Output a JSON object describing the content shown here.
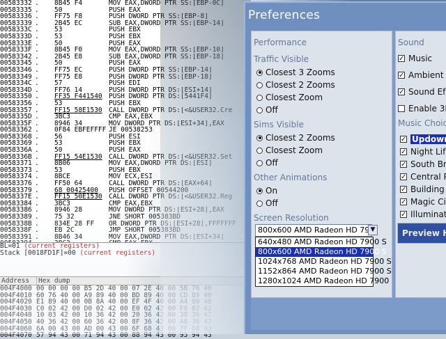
{
  "debugger": {
    "disasm": [
      {
        "addr": "00583332",
        "hex": "8B45 F4",
        "ins": "MOV EAX,DWORD PTR SS:[EBP-0C]"
      },
      {
        "addr": "00583335",
        "hex": "50",
        "ins": "PUSH EAX"
      },
      {
        "addr": "00583336",
        "hex": "FF75 F8",
        "ins": "PUSH DWORD PTR SS:[EBP-8]"
      },
      {
        "addr": "00583339",
        "hex": "2B45 EC",
        "ins": "SUB EAX,DWORD PTR SS:[EBP-14]"
      },
      {
        "addr": "0058333C",
        "hex": "53",
        "ins": "PUSH EBX"
      },
      {
        "addr": "0058333D",
        "hex": "53",
        "ins": "PUSH EBX"
      },
      {
        "addr": "0058333E",
        "hex": "50",
        "ins": "PUSH EAX"
      },
      {
        "addr": "0058333F",
        "hex": "8B45 F0",
        "ins": "MOV EAX,DWORD PTR SS:[EBP-10]"
      },
      {
        "addr": "00583342",
        "hex": "2B45 E8",
        "ins": "SUB EAX,DWORD PTR SS:[EBP-18]"
      },
      {
        "addr": "00583345",
        "hex": "50",
        "ins": "PUSH EAX"
      },
      {
        "addr": "00583346",
        "hex": "FF75 EC",
        "ins": "PUSH DWORD PTR SS:[EBP-14]"
      },
      {
        "addr": "00583349",
        "hex": "FF75 E8",
        "ins": "PUSH DWORD PTR SS:[EBP-18]"
      },
      {
        "addr": "0058334C",
        "hex": "57",
        "ins": "PUSH EDI"
      },
      {
        "addr": "0058334D",
        "hex": "FF76 14",
        "ins": "PUSH DWORD PTR DS:[ESI+14]"
      },
      {
        "addr": "00583350",
        "hex": "FF35 F441540",
        "ins": "PUSH DWORD PTR DS:[5441F4]",
        "u": true
      },
      {
        "addr": "00583356",
        "hex": "53",
        "ins": "PUSH EBX"
      },
      {
        "addr": "00583357",
        "hex": "FF15 58E1530",
        "ins": "CALL DWORD PTR DS:[<&USER32.Cre",
        "u": true
      },
      {
        "addr": "0058335D",
        "hex": "3BC3",
        "ins": "CMP EAX,EBX"
      },
      {
        "addr": "0058335F",
        "hex": "8946 34",
        "ins": "MOV DWORD PTR DS:[ESI+34],EAX"
      },
      {
        "addr": "00583362",
        "hex": "0F84 EBFEFFFF",
        "ins": "JE 00538253"
      },
      {
        "addr": "00583368",
        "hex": "56",
        "ins": "PUSH ESI"
      },
      {
        "addr": "00583369",
        "hex": "53",
        "ins": "PUSH EBX"
      },
      {
        "addr": "0058336A",
        "hex": "50",
        "ins": "PUSH EAX"
      },
      {
        "addr": "0058336B",
        "hex": "FF15 54E1530",
        "ins": "CALL DWORD PTR DS:[<&USER32.Set",
        "u": true
      },
      {
        "addr": "00583371",
        "hex": "8B06",
        "ins": "MOV EAX,DWORD PTR DS:[ESI]"
      },
      {
        "addr": "00583373",
        "hex": "53",
        "ins": "PUSH EBX"
      },
      {
        "addr": "00583374",
        "hex": "8BCE",
        "ins": "MOV ECX,ESI"
      },
      {
        "addr": "00583376",
        "hex": "FF50 64",
        "ins": "CALL DWORD PTR DS:[EAX+64]"
      },
      {
        "addr": "00583379",
        "hex": "68 00425400",
        "ins": "PUSH OFFSET 00544200",
        "u": true
      },
      {
        "addr": "0058337E",
        "hex": "FF15 50E1530",
        "ins": "CALL DWORD PTR DS:[<&USER32.Reg",
        "u": true
      },
      {
        "addr": "00583384",
        "hex": "3BC3",
        "ins": "CMP EAX,EBX"
      },
      {
        "addr": "00583386",
        "hex": "8946 28",
        "ins": "MOV DWORD PTR DS:[ESI+28],EAX"
      },
      {
        "addr": "00583389",
        "hex": "75 32",
        "ins": "JNE SHORT 005383BD"
      },
      {
        "addr": "0058338B",
        "hex": "834E 28 FF",
        "ins": "OR DWORD PTR DS:[ESI+28],FFFFFFF"
      },
      {
        "addr": "0058338F",
        "hex": "EB 2C",
        "ins": "JMP SHORT 005383BD"
      },
      {
        "addr": "00583391",
        "hex": "8B46 34",
        "ins": "MOV EAX,DWORD PTR DS:[ESI+34]"
      },
      {
        "addr": "00583394",
        "hex": "3BC3",
        "ins": "CMP EAX,EBX"
      },
      {
        "addr": "00583396",
        "hex": "74 15",
        "ins": "JE SHORT 005383AD"
      }
    ],
    "reg_line1_label": "BL=01",
    "reg_line1_note": "(current registers)",
    "reg_line2_label": "Stack [0018FD1F]=00",
    "reg_line2_note": "(current registers)",
    "hex_headers": {
      "address": "Address",
      "dump": "Hex dump"
    },
    "hex_rows": [
      {
        "addr": "004F4000",
        "bytes": "00 00 00 00 B5 2D 40 00 07 2E 40 00 5B 76 40"
      },
      {
        "addr": "004F4010",
        "bytes": "60 76 40 00 A9 89 40 00 BD 89 40 00 CD 89 40"
      },
      {
        "addr": "004F4020",
        "bytes": "E1 89 40 00 0B 8A 40 00 EF 4F 40 00 A4 90 40"
      },
      {
        "addr": "004F4030",
        "bytes": "C0 02 42 00 D0 02 42 00 E0 02 42 00 F0 02 42"
      },
      {
        "addr": "004F4040",
        "bytes": "10 03 42 00 10 36 42 00 20 36 42 00 38 36 42"
      },
      {
        "addr": "004F4050",
        "bytes": "40 36 42 00 60 36 42 00 8F 36 42 00 A0 36 42"
      },
      {
        "addr": "004F4060",
        "bytes": "6A 00 43 00 AD 00 43 00 6F 68 43 00 7F 68 43"
      },
      {
        "addr": "004F4070",
        "bytes": "57 94 43 00 71 94 43 00 88 94 43 00 95 94 43"
      }
    ]
  },
  "prefs": {
    "title": "Preferences",
    "performance": {
      "heading": "Performance",
      "traffic": {
        "heading": "Traffic Visible",
        "options": [
          "Closest 3 Zooms",
          "Closest 2 Zooms",
          "Closest Zoom",
          "Off"
        ],
        "selected": 0
      },
      "sims": {
        "heading": "Sims Visible",
        "options": [
          "Closest 2 Zooms",
          "Closest Zoom",
          "Off"
        ],
        "selected": 0
      },
      "animations": {
        "heading": "Other Animations",
        "options": [
          "On",
          "Off"
        ],
        "selected": 0
      },
      "resolution": {
        "heading": "Screen Resolution",
        "current": "800x600 AMD Radeon HD 790",
        "options": [
          "640x480 AMD Radeon HD 7900 S",
          "800x600 AMD Radeon HD 7900 S",
          "1024x768 AMD Radeon HD 7900 S",
          "1152x864 AMD Radeon HD 7900 S",
          "1280x1024 AMD Radeon HD 7900"
        ],
        "selected": 1
      }
    },
    "sound": {
      "heading": "Sound",
      "items": [
        {
          "label": "Music",
          "checked": true
        },
        {
          "label": "Ambient",
          "checked": true
        },
        {
          "label": "Sound Ef",
          "checked": true
        },
        {
          "label": "Enable 3D",
          "checked": false
        }
      ],
      "music_choice_heading": "Music Choic",
      "music_items": [
        {
          "label": "Updown",
          "checked": true
        },
        {
          "label": "Night Lif",
          "checked": true
        },
        {
          "label": "South Br",
          "checked": true
        },
        {
          "label": "Central P",
          "checked": true
        },
        {
          "label": "Building",
          "checked": true
        },
        {
          "label": "Magic Ci",
          "checked": true
        },
        {
          "label": "Illuminati",
          "checked": true
        }
      ],
      "music_selected": 0,
      "preview_label": "Preview Hi"
    }
  },
  "colors": {
    "accent": "#1a2fb8",
    "window": "#6f8fbf",
    "panel": "#dde3ea",
    "register_note": "#d00000"
  }
}
